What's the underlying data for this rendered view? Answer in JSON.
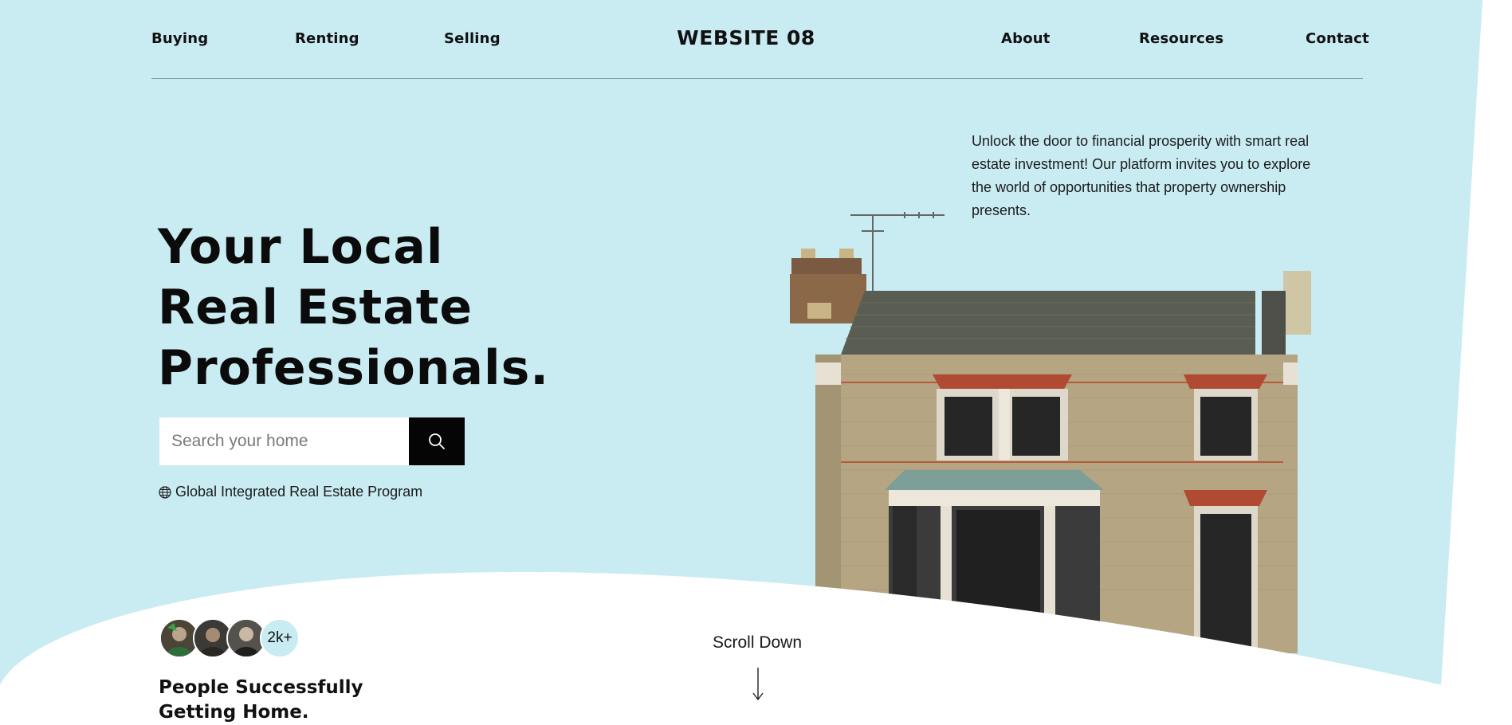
{
  "nav": {
    "left": [
      "Buying",
      "Renting",
      "Selling"
    ],
    "logo": "WEBSITE 08",
    "right": [
      "About",
      "Resources",
      "Contact"
    ]
  },
  "hero": {
    "title_lines": [
      "Your Local",
      "Real Estate",
      "Professionals."
    ],
    "intro": "Unlock the door to financial prosperity with smart real estate investment! Our platform invites you to explore the world of opportunities that property ownership presents."
  },
  "search": {
    "placeholder": "Search your home",
    "button_icon": "search-icon"
  },
  "program": {
    "icon": "globe-icon",
    "label": "Global Integrated Real Estate Program"
  },
  "social_proof": {
    "count": "2k+",
    "title_lines": [
      "People Successfully",
      "Getting Home."
    ]
  },
  "scroll": {
    "label": "Scroll Down",
    "icon": "arrow-down-icon"
  },
  "colors": {
    "background": "#c9ebf2",
    "wave": "#ffffff",
    "button": "#050505",
    "text": "#111111"
  }
}
